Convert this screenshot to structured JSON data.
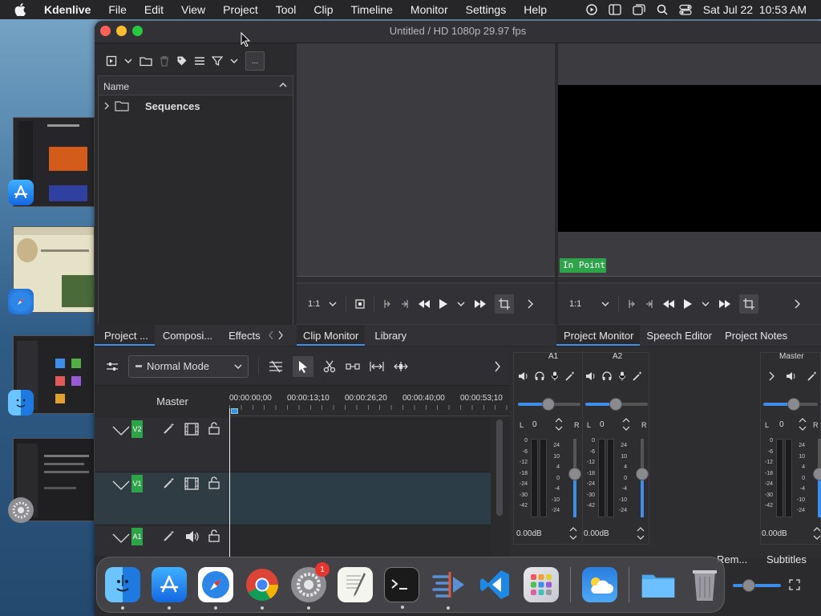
{
  "menubar": {
    "app_name": "Kdenlive",
    "items": [
      "File",
      "Edit",
      "View",
      "Project",
      "Tool",
      "Clip",
      "Timeline",
      "Monitor",
      "Settings",
      "Help"
    ],
    "datetime": "Sat Jul 22  10:53 AM"
  },
  "window": {
    "title": "Untitled / HD 1080p 29.97 fps"
  },
  "bin": {
    "search_label": "...",
    "column_name": "Name",
    "folder": "Sequences"
  },
  "left_tabs": [
    "Project ...",
    "Composi...",
    "Effects"
  ],
  "monitor_tabs": [
    "Clip Monitor",
    "Library"
  ],
  "right_tabs": [
    "Project Monitor",
    "Speech Editor",
    "Project Notes"
  ],
  "clip_monitor": {
    "zoom": "1:1"
  },
  "project_monitor": {
    "zoom": "1:1",
    "in_point_label": "In Point"
  },
  "timeline": {
    "mode": "Normal Mode",
    "master_label": "Master",
    "timecodes": [
      "00:00:00;00",
      "00:00:13;10",
      "00:00:26;20",
      "00:00:40;00",
      "00:00:53;10"
    ],
    "tracks": [
      {
        "name": "V2",
        "type": "video"
      },
      {
        "name": "V1",
        "type": "video"
      },
      {
        "name": "A1",
        "type": "audio"
      }
    ]
  },
  "mixer": {
    "channels": [
      {
        "name": "A1",
        "value": "0",
        "db": "0.00dB"
      },
      {
        "name": "A2",
        "value": "0",
        "db": "0.00dB"
      }
    ],
    "master": {
      "name": "Master",
      "value": "0",
      "db": "0.00dB"
    },
    "left_label": "L",
    "right_label": "R",
    "scale_left": [
      "0",
      "-6",
      "-12",
      "-18",
      "-24",
      "-30",
      "-42"
    ],
    "scale_right": [
      "24",
      "10",
      "4",
      "0",
      "-4",
      "-10",
      "-24"
    ]
  },
  "bottom_tabs": [
    "Rem...",
    "Subtitles"
  ],
  "dock": {
    "badge_settings": "1",
    "apps": [
      "finder-icon",
      "app-store-icon",
      "safari-icon",
      "chrome-icon",
      "system-settings-icon",
      "textedit-icon",
      "terminal-icon",
      "kdenlive-icon",
      "vscode-icon",
      "launchpad-icon",
      "weather-icon",
      "folder-icon",
      "trash-icon"
    ]
  },
  "colors": {
    "accent": "#3d8ee8",
    "track_green": "#2fa34a",
    "in_point": "#2fa34a"
  }
}
